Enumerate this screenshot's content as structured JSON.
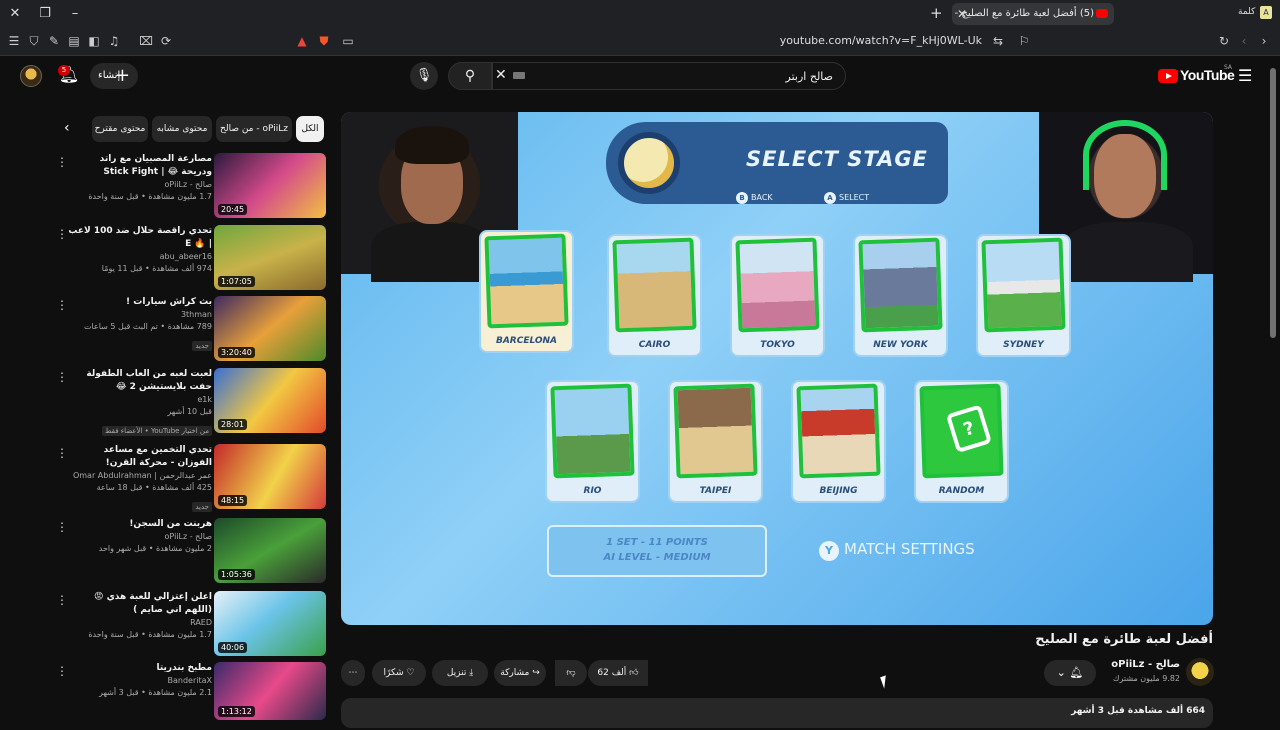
{
  "browser": {
    "tab_title": "(5) أفضل لعبة طائرة مع الصليح -",
    "profile_label": "كلمة",
    "url": "youtube.com/watch?v=F_kHj0WL-Uk"
  },
  "header": {
    "create_label": "إنشاء",
    "notifications_count": "5",
    "search_value": "صالح اربتر",
    "logo_text": "YouTube",
    "logo_region": "SA"
  },
  "chips": {
    "items": [
      "الكل",
      "من صالح - oPiiLz",
      "محتوى مشابه",
      "محتوى مقترح"
    ]
  },
  "recommendations": [
    {
      "title": "مصارعة المصبيان مع راتد ودريحة 😂 | Stick Fight",
      "channel": "صالح - oPiiLz",
      "meta": "1.7 مليون مشاهدة • قبل سنة واحدة",
      "duration": "20:45",
      "badge": ""
    },
    {
      "title": "تحدي راقصة حلال ضد 100 لاعب | 🔥 E",
      "channel": "abu_abeer16",
      "meta": "974 ألف مشاهدة • قبل 11 يومًا",
      "duration": "1:07:05",
      "badge": ""
    },
    {
      "title": "بث كراش سيارات !",
      "channel": "3thman",
      "meta": "789 مشاهدة • تم البث قبل 5 ساعات",
      "duration": "3:20:40",
      "badge": "جديد"
    },
    {
      "title": "لعبت لعبه من العاب الطفولة حفت بلايستيشن 2 😂",
      "channel": "e1k",
      "meta": "قبل 10 أشهر",
      "duration": "28:01",
      "badge": "من اختيار YouTube • الأعضاء فقط"
    },
    {
      "title": "تحدي التخمين مع مساعد الفوزان - محركة القرن!",
      "channel": "عمر عبدالرحمن | Omar Abdulrahman",
      "meta": "425 ألف مشاهدة • قبل 18 ساعة",
      "duration": "48:15",
      "badge": "جديد"
    },
    {
      "title": "هربنت من السجن!",
      "channel": "صالح - oPiiLz",
      "meta": "2 مليون مشاهدة • قبل شهر واحد",
      "duration": "1:05:36",
      "badge": ""
    },
    {
      "title": "اعلن إعتزالي للعبة هذي 😡 (اللهم اني صايم )",
      "channel": "RAED",
      "meta": "1.7 مليون مشاهدة • قبل سنة واحدة",
      "duration": "40:06",
      "badge": ""
    },
    {
      "title": "مطبخ بندريتا",
      "channel": "BanderitaX",
      "meta": "2.1 مليون مشاهدة • قبل 3 أشهر",
      "duration": "1:13:12",
      "badge": ""
    }
  ],
  "game": {
    "stage_title": "SELECT STAGE",
    "back_label": "BACK",
    "back_key": "B",
    "select_label": "SELECT",
    "select_key": "A",
    "stages": [
      "BARCELONA",
      "CAIRO",
      "TOKYO",
      "NEW YORK",
      "SYDNEY",
      "RIO",
      "TAIPEI",
      "BEIJING",
      "RANDOM"
    ],
    "set_line1": "1 SET - 11 POINTS",
    "set_line2": "AI LEVEL - MEDIUM",
    "match_settings_key": "Y",
    "match_settings_label": "MATCH SETTINGS"
  },
  "video": {
    "title": "أفضل لعبة طائرة مع الصليح",
    "channel_name": "صالح - oPiiLz",
    "subscribers": "9.82 مليون مشترك",
    "likes": "62 ألف",
    "share_label": "مشاركة",
    "download_label": "تنزيل",
    "thanks_label": "شكرًا",
    "views_meta": "664 ألف مشاهدة قبل 3 أشهر"
  },
  "colors": {
    "background": "#0f0f0f",
    "chip": "#272727",
    "brand_red": "#ff0000",
    "stage_green": "#1fc13a",
    "game_sky": "#5fb6ef"
  }
}
